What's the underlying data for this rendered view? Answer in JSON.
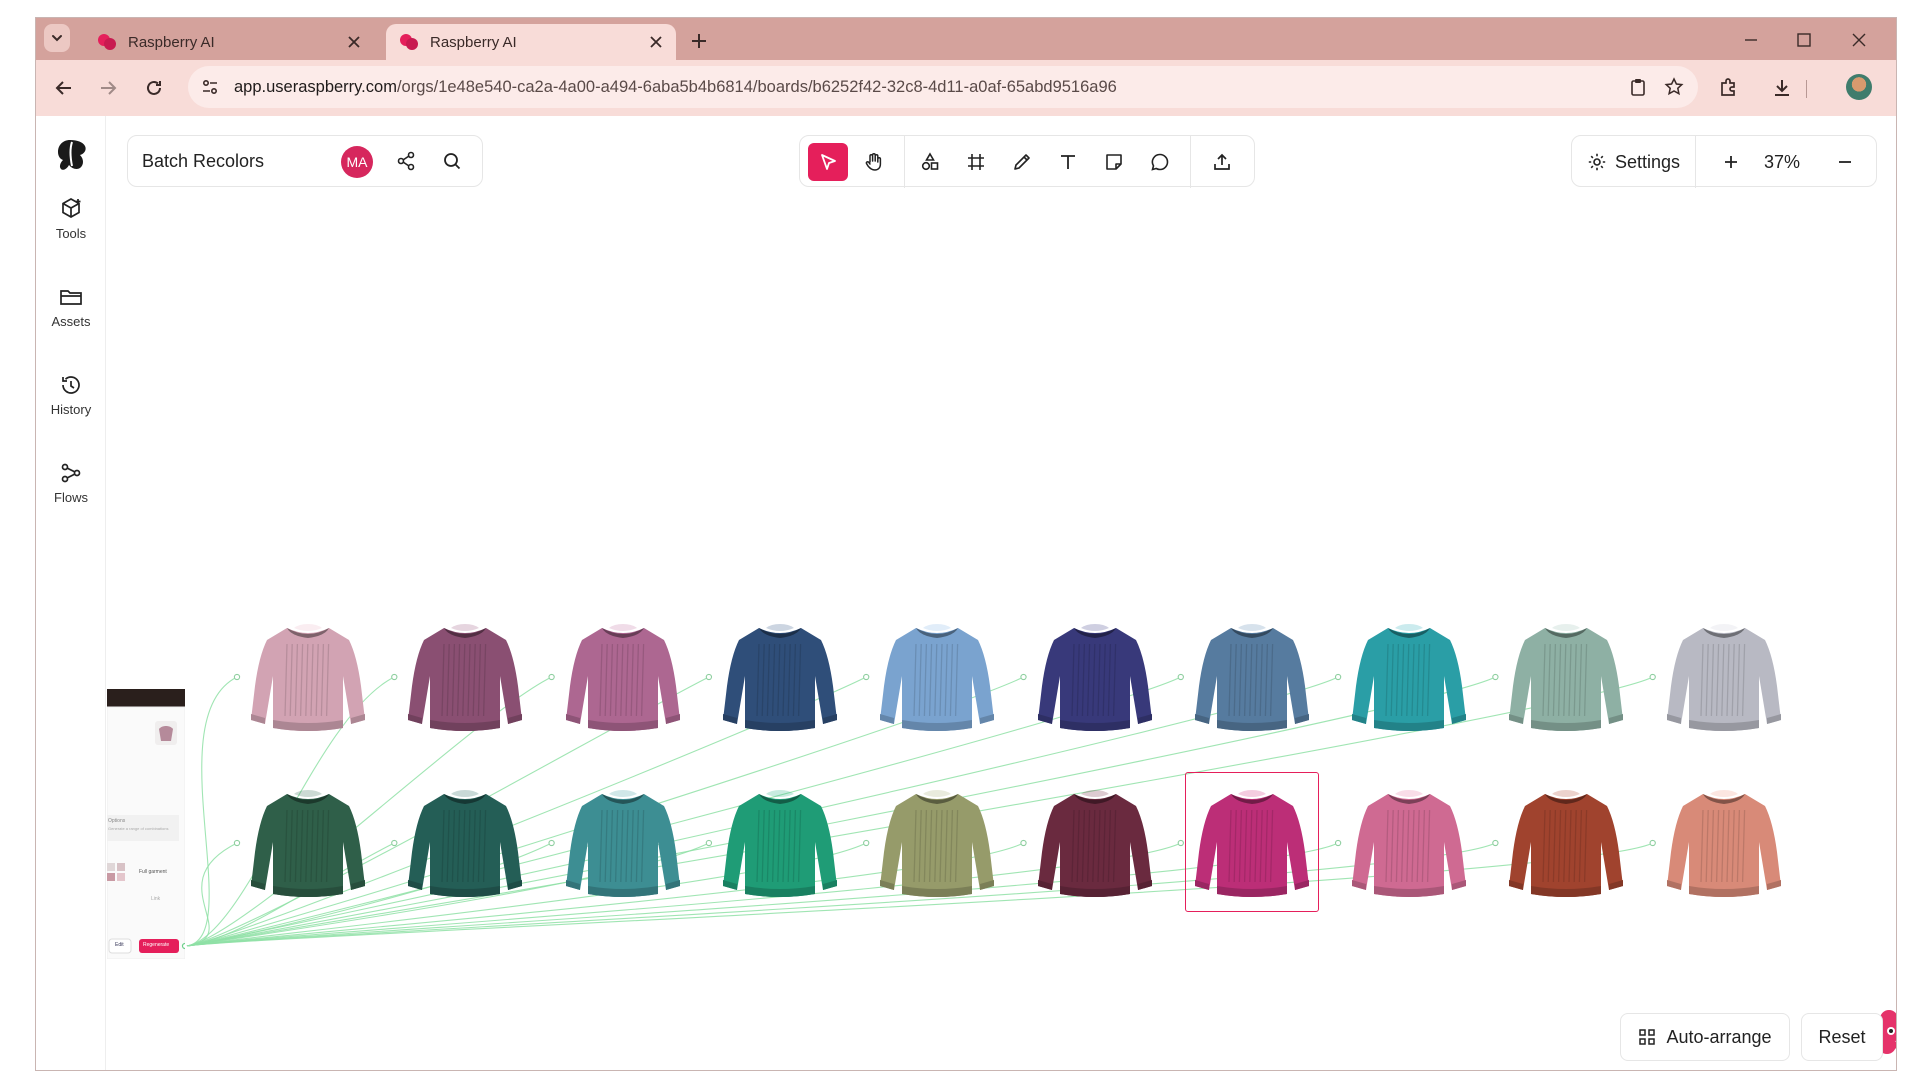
{
  "browser": {
    "tabs": [
      {
        "title": "Raspberry AI",
        "active": false
      },
      {
        "title": "Raspberry AI",
        "active": true
      }
    ],
    "url_host": "app.useraspberry.com",
    "url_path": "/orgs/1e48e540-ca2a-4a00-a494-6aba5b4b6814/boards/b6252f42-32c8-4d11-a0af-65abd9516a96"
  },
  "sidebar": {
    "items": [
      {
        "label": "Tools",
        "icon": "package-plus-icon"
      },
      {
        "label": "Assets",
        "icon": "folder-icon"
      },
      {
        "label": "History",
        "icon": "history-icon"
      },
      {
        "label": "Flows",
        "icon": "flows-icon"
      }
    ]
  },
  "board": {
    "name": "Batch Recolors",
    "avatar_initials": "MA"
  },
  "toolbar": {
    "tools": [
      "select-icon",
      "hand-icon",
      "shapes-icon",
      "frame-icon",
      "pencil-icon",
      "text-icon",
      "sticky-note-icon",
      "comment-icon",
      "export-icon"
    ],
    "active_tool": "select-icon",
    "accent": "#e51f5b"
  },
  "zoom": {
    "settings_label": "Settings",
    "value": "37%"
  },
  "sweaters": {
    "row1": [
      "#d2a3b3",
      "#8a4f72",
      "#ad6791",
      "#2f4e79",
      "#7aa3cf",
      "#38397a",
      "#567b9f",
      "#2a9ea6",
      "#8eb0a4",
      "#b8b9c3"
    ],
    "row2": [
      "#2f5f49",
      "#245e56",
      "#3d8e93",
      "#1f9c76",
      "#969b6a",
      "#6a2a3f",
      "#bc2e77",
      "#cf6a92",
      "#a0432e",
      "#d88a78"
    ],
    "selected_row": 2,
    "selected_index": 7
  },
  "node_card": {
    "edit_label": "Edit",
    "regenerate_label": "Regenerate",
    "full_garment_label": "Full garment",
    "options_label": "Options",
    "options_sub": "Generate a range of combinations",
    "link_label": "Link",
    "brand_color": "#e51f5b"
  },
  "actions": {
    "auto_arrange_label": "Auto-arrange",
    "reset_label": "Reset"
  }
}
